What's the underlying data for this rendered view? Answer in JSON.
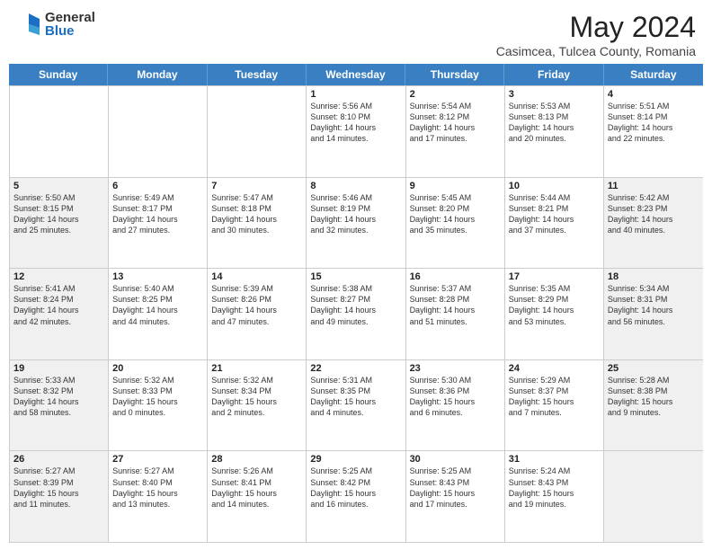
{
  "header": {
    "logo_general": "General",
    "logo_blue": "Blue",
    "month_title": "May 2024",
    "location": "Casimcea, Tulcea County, Romania"
  },
  "weekdays": [
    "Sunday",
    "Monday",
    "Tuesday",
    "Wednesday",
    "Thursday",
    "Friday",
    "Saturday"
  ],
  "rows": [
    [
      {
        "day": "",
        "text": "",
        "gray": false
      },
      {
        "day": "",
        "text": "",
        "gray": false
      },
      {
        "day": "",
        "text": "",
        "gray": false
      },
      {
        "day": "1",
        "text": "Sunrise: 5:56 AM\nSunset: 8:10 PM\nDaylight: 14 hours\nand 14 minutes.",
        "gray": false
      },
      {
        "day": "2",
        "text": "Sunrise: 5:54 AM\nSunset: 8:12 PM\nDaylight: 14 hours\nand 17 minutes.",
        "gray": false
      },
      {
        "day": "3",
        "text": "Sunrise: 5:53 AM\nSunset: 8:13 PM\nDaylight: 14 hours\nand 20 minutes.",
        "gray": false
      },
      {
        "day": "4",
        "text": "Sunrise: 5:51 AM\nSunset: 8:14 PM\nDaylight: 14 hours\nand 22 minutes.",
        "gray": false
      }
    ],
    [
      {
        "day": "5",
        "text": "Sunrise: 5:50 AM\nSunset: 8:15 PM\nDaylight: 14 hours\nand 25 minutes.",
        "gray": true
      },
      {
        "day": "6",
        "text": "Sunrise: 5:49 AM\nSunset: 8:17 PM\nDaylight: 14 hours\nand 27 minutes.",
        "gray": false
      },
      {
        "day": "7",
        "text": "Sunrise: 5:47 AM\nSunset: 8:18 PM\nDaylight: 14 hours\nand 30 minutes.",
        "gray": false
      },
      {
        "day": "8",
        "text": "Sunrise: 5:46 AM\nSunset: 8:19 PM\nDaylight: 14 hours\nand 32 minutes.",
        "gray": false
      },
      {
        "day": "9",
        "text": "Sunrise: 5:45 AM\nSunset: 8:20 PM\nDaylight: 14 hours\nand 35 minutes.",
        "gray": false
      },
      {
        "day": "10",
        "text": "Sunrise: 5:44 AM\nSunset: 8:21 PM\nDaylight: 14 hours\nand 37 minutes.",
        "gray": false
      },
      {
        "day": "11",
        "text": "Sunrise: 5:42 AM\nSunset: 8:23 PM\nDaylight: 14 hours\nand 40 minutes.",
        "gray": true
      }
    ],
    [
      {
        "day": "12",
        "text": "Sunrise: 5:41 AM\nSunset: 8:24 PM\nDaylight: 14 hours\nand 42 minutes.",
        "gray": true
      },
      {
        "day": "13",
        "text": "Sunrise: 5:40 AM\nSunset: 8:25 PM\nDaylight: 14 hours\nand 44 minutes.",
        "gray": false
      },
      {
        "day": "14",
        "text": "Sunrise: 5:39 AM\nSunset: 8:26 PM\nDaylight: 14 hours\nand 47 minutes.",
        "gray": false
      },
      {
        "day": "15",
        "text": "Sunrise: 5:38 AM\nSunset: 8:27 PM\nDaylight: 14 hours\nand 49 minutes.",
        "gray": false
      },
      {
        "day": "16",
        "text": "Sunrise: 5:37 AM\nSunset: 8:28 PM\nDaylight: 14 hours\nand 51 minutes.",
        "gray": false
      },
      {
        "day": "17",
        "text": "Sunrise: 5:35 AM\nSunset: 8:29 PM\nDaylight: 14 hours\nand 53 minutes.",
        "gray": false
      },
      {
        "day": "18",
        "text": "Sunrise: 5:34 AM\nSunset: 8:31 PM\nDaylight: 14 hours\nand 56 minutes.",
        "gray": true
      }
    ],
    [
      {
        "day": "19",
        "text": "Sunrise: 5:33 AM\nSunset: 8:32 PM\nDaylight: 14 hours\nand 58 minutes.",
        "gray": true
      },
      {
        "day": "20",
        "text": "Sunrise: 5:32 AM\nSunset: 8:33 PM\nDaylight: 15 hours\nand 0 minutes.",
        "gray": false
      },
      {
        "day": "21",
        "text": "Sunrise: 5:32 AM\nSunset: 8:34 PM\nDaylight: 15 hours\nand 2 minutes.",
        "gray": false
      },
      {
        "day": "22",
        "text": "Sunrise: 5:31 AM\nSunset: 8:35 PM\nDaylight: 15 hours\nand 4 minutes.",
        "gray": false
      },
      {
        "day": "23",
        "text": "Sunrise: 5:30 AM\nSunset: 8:36 PM\nDaylight: 15 hours\nand 6 minutes.",
        "gray": false
      },
      {
        "day": "24",
        "text": "Sunrise: 5:29 AM\nSunset: 8:37 PM\nDaylight: 15 hours\nand 7 minutes.",
        "gray": false
      },
      {
        "day": "25",
        "text": "Sunrise: 5:28 AM\nSunset: 8:38 PM\nDaylight: 15 hours\nand 9 minutes.",
        "gray": true
      }
    ],
    [
      {
        "day": "26",
        "text": "Sunrise: 5:27 AM\nSunset: 8:39 PM\nDaylight: 15 hours\nand 11 minutes.",
        "gray": true
      },
      {
        "day": "27",
        "text": "Sunrise: 5:27 AM\nSunset: 8:40 PM\nDaylight: 15 hours\nand 13 minutes.",
        "gray": false
      },
      {
        "day": "28",
        "text": "Sunrise: 5:26 AM\nSunset: 8:41 PM\nDaylight: 15 hours\nand 14 minutes.",
        "gray": false
      },
      {
        "day": "29",
        "text": "Sunrise: 5:25 AM\nSunset: 8:42 PM\nDaylight: 15 hours\nand 16 minutes.",
        "gray": false
      },
      {
        "day": "30",
        "text": "Sunrise: 5:25 AM\nSunset: 8:43 PM\nDaylight: 15 hours\nand 17 minutes.",
        "gray": false
      },
      {
        "day": "31",
        "text": "Sunrise: 5:24 AM\nSunset: 8:43 PM\nDaylight: 15 hours\nand 19 minutes.",
        "gray": false
      },
      {
        "day": "",
        "text": "",
        "gray": true
      }
    ]
  ]
}
